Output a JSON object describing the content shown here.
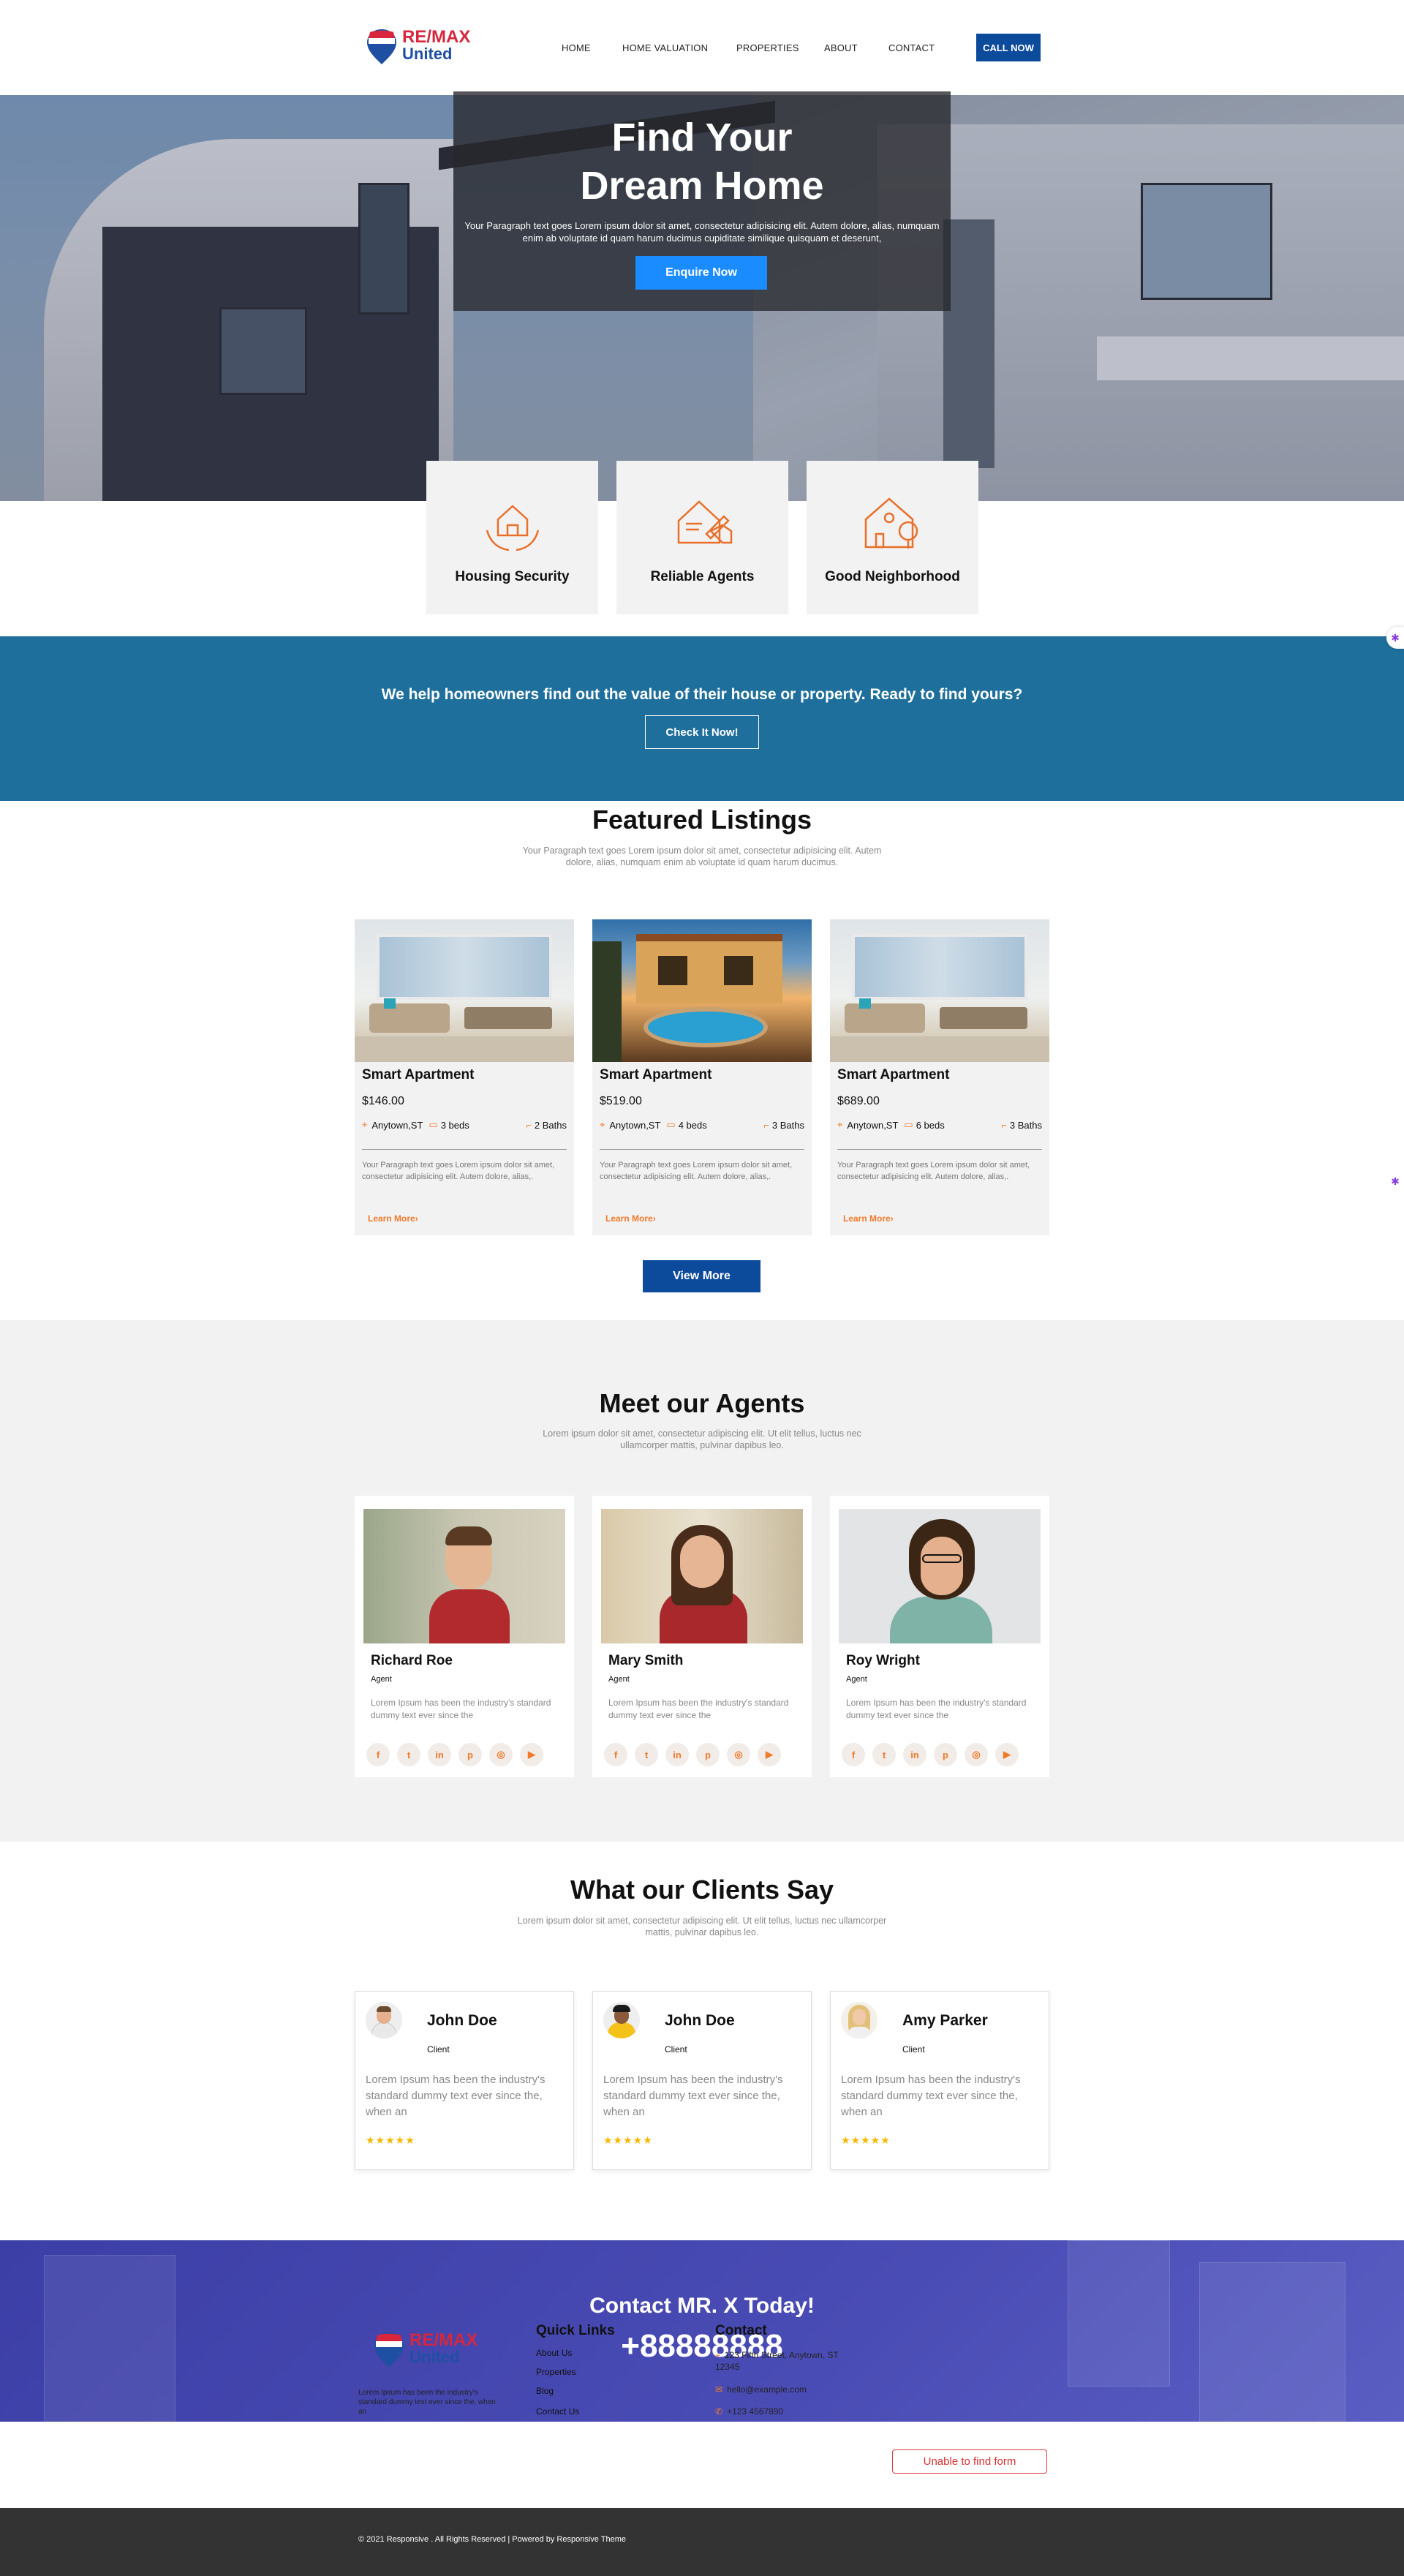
{
  "header": {
    "logo": {
      "line1": "RE/MAX",
      "line2": "United",
      "mark": "RE/MAX"
    },
    "nav": [
      "HOME",
      "HOME VALUATION",
      "PROPERTIES",
      "ABOUT",
      "CONTACT"
    ],
    "cta": "CALL NOW"
  },
  "hero": {
    "title_line1": "Find Your",
    "title_line2": "Dream Home",
    "text": "Your Paragraph text goes Lorem ipsum dolor sit amet, consectetur adipisicing elit. Autem dolore, alias, numquam enim ab voluptate id quam harum ducimus cupiditate similique quisquam et deserunt,",
    "button": "Enquire Now"
  },
  "features": [
    {
      "label": "Housing Security",
      "icon": "house-hands-icon"
    },
    {
      "label": "Reliable Agents",
      "icon": "house-contract-icon"
    },
    {
      "label": "Good Neighborhood",
      "icon": "house-tree-icon"
    }
  ],
  "valuation": {
    "title": "We help homeowners find out the value of their house or property. Ready to find yours?",
    "button": "Check It Now!"
  },
  "listings": {
    "title": "Featured Listings",
    "subtitle": "Your Paragraph text goes Lorem ipsum dolor sit amet, consectetur adipisicing elit. Autem dolore, alias, numquam enim ab voluptate id quam harum ducimus.",
    "items": [
      {
        "title": "Smart Apartment",
        "price": "$146.00",
        "location": "Anytown,ST",
        "beds": "3 beds",
        "baths": "2 Baths",
        "desc": "Your Paragraph text goes Lorem ipsum dolor sit amet, consectetur adipisicing elit. Autem dolore, alias,.",
        "link": "Learn More"
      },
      {
        "title": "Smart Apartment",
        "price": "$519.00",
        "location": "Anytown,ST",
        "beds": "4 beds",
        "baths": "3 Baths",
        "desc": "Your Paragraph text goes Lorem ipsum dolor sit amet, consectetur adipisicing elit. Autem dolore, alias,.",
        "link": "Learn More"
      },
      {
        "title": "Smart Apartment",
        "price": "$689.00",
        "location": "Anytown,ST",
        "beds": "6 beds",
        "baths": "3 Baths",
        "desc": "Your Paragraph text goes Lorem ipsum dolor sit amet, consectetur adipisicing elit. Autem dolore, alias,.",
        "link": "Learn More"
      }
    ],
    "button": "View More"
  },
  "agents": {
    "title": "Meet our Agents",
    "subtitle": "Lorem ipsum dolor sit amet, consectetur adipiscing elit. Ut elit tellus, luctus nec ullamcorper mattis, pulvinar dapibus leo.",
    "items": [
      {
        "name": "Richard Roe",
        "role": "Agent",
        "desc": "Lorem Ipsum has been the industry's standard dummy text ever since the"
      },
      {
        "name": "Mary Smith",
        "role": "Agent",
        "desc": "Lorem Ipsum has been the industry's standard dummy text ever since the"
      },
      {
        "name": "Roy Wright",
        "role": "Agent",
        "desc": "Lorem Ipsum has been the industry's standard dummy text ever since the"
      }
    ],
    "social_icons": [
      "facebook-icon",
      "twitter-icon",
      "linkedin-icon",
      "pinterest-icon",
      "instagram-icon",
      "youtube-icon"
    ]
  },
  "testimonials": {
    "title": "What our Clients Say",
    "subtitle": "Lorem ipsum dolor sit amet, consectetur adipiscing elit. Ut elit tellus, luctus nec ullamcorper mattis, pulvinar dapibus leo.",
    "items": [
      {
        "name": "John Doe",
        "role": "Client",
        "text": "Lorem Ipsum has been the industry's standard dummy text ever since the, when an",
        "stars": "★★★★★"
      },
      {
        "name": "John Doe",
        "role": "Client",
        "text": "Lorem Ipsum has been the industry's standard dummy text ever since the, when an",
        "stars": "★★★★★"
      },
      {
        "name": "Amy Parker",
        "role": "Client",
        "text": "Lorem Ipsum has been the industry's standard dummy text ever since the, when an",
        "stars": "★★★★★"
      }
    ]
  },
  "contact": {
    "title": "Contact MR. X Today!",
    "phone": "+88888888",
    "footer_text": "Lorem Ipsum has been the industry's standard dummy text ever since the, when an",
    "quick_links_title": "Quick Links",
    "quick_links": [
      "About Us",
      "Properties",
      "Blog",
      "Contact Us"
    ],
    "contact_title": "Contact",
    "address": "123 Fifth Street, Anytown, ST 12345",
    "email": "hello@example.com",
    "phone_small": "+123 4567890"
  },
  "form_error": "Unable to find form",
  "footer": {
    "copyright": "© 2021 Responsive . All Rights Reserved | Powered by Responsive Theme"
  },
  "colors": {
    "brand_blue": "#0c4a9b",
    "accent_orange": "#f07a2a",
    "band_blue": "#1f6f9c",
    "contact_purple": "#4a4cb5"
  }
}
